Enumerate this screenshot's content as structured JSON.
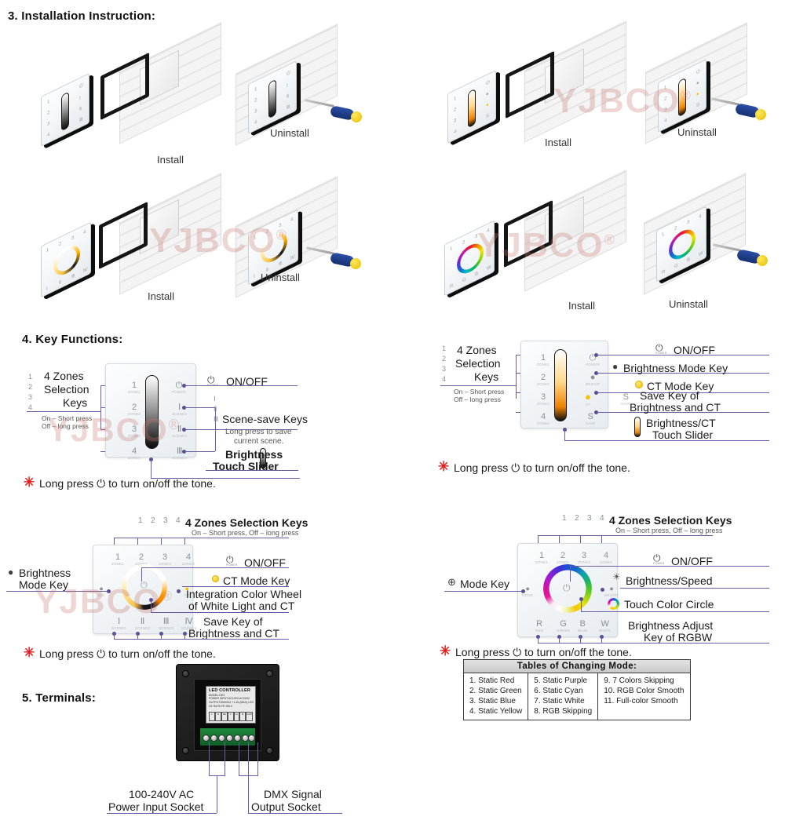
{
  "sections": {
    "installation": {
      "number": "3.",
      "title": "Installation Instruction:",
      "heading": "3. Installation Instruction:"
    },
    "key_functions": {
      "number": "4.",
      "title": "Key Functions:",
      "heading": "4. Key Functions:"
    },
    "terminals": {
      "number": "5.",
      "title": "Terminals:",
      "heading": "5. Terminals:"
    }
  },
  "watermark": {
    "text": "YJBCO",
    "registered": "®"
  },
  "installation": {
    "diagrams": [
      {
        "id": "dimmer-install",
        "caption": "Install",
        "panel_type": "dimmer"
      },
      {
        "id": "dimmer-uninstall",
        "caption": "Uninstall",
        "panel_type": "dimmer"
      },
      {
        "id": "ct-slider-install",
        "caption": "Install",
        "panel_type": "ct-slider"
      },
      {
        "id": "ct-slider-uninstall",
        "caption": "Uninstall",
        "panel_type": "ct-slider"
      },
      {
        "id": "ct-wheel-install",
        "caption": "Install",
        "panel_type": "ct-wheel"
      },
      {
        "id": "ct-wheel-uninstall",
        "caption": "Uninstall",
        "panel_type": "ct-wheel"
      },
      {
        "id": "rgbw-install",
        "caption": "Install",
        "panel_type": "rgbw"
      },
      {
        "id": "rgbw-uninstall",
        "caption": "Uninstall",
        "panel_type": "rgbw"
      }
    ]
  },
  "zone_keys": {
    "k1": "1",
    "k2": "2",
    "k3": "3",
    "k4": "4"
  },
  "zone_subs": {
    "s1": "ZONE1",
    "s2": "ZONE2",
    "s3": "ZONE3",
    "s4": "ZONE4"
  },
  "scene_keys": {
    "k1": "Ⅰ",
    "k2": "Ⅱ",
    "k3": "Ⅲ",
    "k4": "Ⅳ"
  },
  "scene_subs": {
    "s1": "SCENE1",
    "s2": "SCENE2",
    "s3": "SCENE3",
    "s4": "SCENE4"
  },
  "rgbw_keys": {
    "r": "R",
    "g": "G",
    "b": "B",
    "w": "W"
  },
  "rgbw_subs": {
    "r": "RED",
    "g": "GREEN",
    "b": "BLUE",
    "w": "WHITE"
  },
  "tone_note": {
    "star": "✳",
    "before": "Long press",
    "glyph": "⏻",
    "after": "to turn on/off the tone.",
    "full": "Long press ⏻ to turn on/off the tone."
  },
  "diagram_dimmer": {
    "title": "4 Zones Selection Keys",
    "zones_label_l1": "4 Zones",
    "zones_label_l2": "Selection",
    "zones_label_l3": "Keys",
    "press_on": "On – Short press",
    "press_off": "Off – long press",
    "zone_strip": "1 2 3 4",
    "onoff": "ON/OFF",
    "power_cap": "POWER",
    "scene_title": "Scene-save Keys",
    "scene_note_l1": "Long press to save",
    "scene_note_l2": "current scene.",
    "scene_strip": "Ⅰ Ⅱ Ⅲ",
    "slider_l1": "Brightness",
    "slider_l2": "Touch Slider"
  },
  "diagram_ct_slider": {
    "zones_label_l1": "4 Zones",
    "zones_label_l2": "Selection",
    "zones_label_l3": "Keys",
    "press_on": "On – Short press",
    "press_off": "Off – long press",
    "onoff": "ON/OFF",
    "brightness_mode": "Brightness Mode Key",
    "ct_mode": "CT Mode Key",
    "save_l1": "Save Key of",
    "save_l2": "Brightness and CT",
    "save_key_glyph": "S",
    "save_key_sub": "SAVE",
    "slider_l1": "Brightness/CT",
    "slider_l2": "Touch Slider",
    "keys_right": {
      "power": "⏻",
      "brightness": "Ὂ1",
      "ct": "●",
      "save": "S"
    }
  },
  "diagram_ct_wheel": {
    "zones_title": "4 Zones Selection Keys",
    "zones_note": "On – Short press, Off – long press",
    "zone_strip": "1 2 3 4",
    "brightness_l1": "Brightness",
    "brightness_l2": "Mode Key",
    "onoff": "ON/OFF",
    "ct_mode": "CT Mode Key",
    "wheel_l1": "Integration Color Wheel",
    "wheel_l2": "of White Light and CT",
    "save_l1": "Save Key of",
    "save_l2": "Brightness and CT"
  },
  "diagram_rgbw": {
    "zones_title": "4 Zones Selection Keys",
    "zones_note": "On – Short press, Off – long press",
    "zone_strip": "1 2 3 4",
    "mode_key": "Mode Key",
    "mode_glyph": "⊕",
    "onoff": "ON/OFF",
    "brightness_speed": "Brightness/Speed",
    "touch_color_circle": "Touch Color Circle",
    "rgbw_l1": "Brightness Adjust",
    "rgbw_l2": "Key of RGBW",
    "mode_sub": "MODE",
    "bright_sub": "SPEED/BRIGHT"
  },
  "modes_table": {
    "title": "Tables of Changing Mode:",
    "columns": [
      [
        "1. Static Red",
        "2. Static Green",
        "3. Static Blue",
        "4. Static Yellow"
      ],
      [
        "5. Static Purple",
        "6. Static Cyan",
        "7. Static White",
        "8. RGB Skipping"
      ],
      [
        "9.  7 Colors Skipping",
        "10. RGB Color Smooth",
        "11. Full-color Smooth"
      ]
    ]
  },
  "terminals": {
    "power_l1": "100-240V AC",
    "power_l2": "Power Input Socket",
    "dmx_l1": "DMX Signal",
    "dmx_l2": "Output Socket",
    "device_label": {
      "title": "LED CONTROLLER",
      "model": "MODEL:DE3",
      "power_input": "POWER INPUT:AC100V-AC240V",
      "output": "OUTPUT:DMX512 +1.4A (MAX) LED",
      "cert_1": "CE",
      "cert_2": "RoHS",
      "cert_3": "FE",
      "cert_4": "SELV",
      "diagram_note": "1.2.3 LF",
      "row_left": "POWER INPUT",
      "row_right": "DMX OUTPUT",
      "cells_left": [
        "L",
        "N",
        "PE",
        "∓"
      ],
      "cells_right": [
        "A+",
        "B-",
        "GND"
      ]
    }
  },
  "colors": {
    "lead_line": "#6b5ca5",
    "star_red": "#e02020",
    "watermark": "rgba(196,118,110,0.30)",
    "text": "#1a1a1a",
    "key_grey": "#8b9096",
    "terminal_green": "#1f8a3c",
    "ct_yellow": "#f2c200"
  }
}
